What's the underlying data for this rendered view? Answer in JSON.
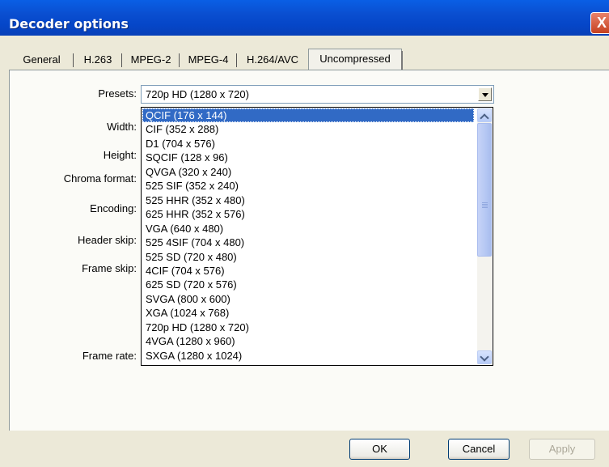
{
  "window": {
    "title": "Decoder options",
    "close_label": "X"
  },
  "tabs": [
    {
      "label": "General"
    },
    {
      "label": "H.263"
    },
    {
      "label": "MPEG-2"
    },
    {
      "label": "MPEG-4"
    },
    {
      "label": "H.264/AVC"
    },
    {
      "label": "Uncompressed"
    }
  ],
  "form": {
    "presets_label": "Presets:",
    "width_label": "Width:",
    "height_label": "Height:",
    "chroma_label": "Chroma format:",
    "encoding_label": "Encoding:",
    "header_skip_label": "Header skip:",
    "frame_skip_label": "Frame skip:",
    "frame_rate_label": "Frame rate:"
  },
  "presets": {
    "selected": "720p HD (1280 x 720)",
    "highlighted_index": 0,
    "options": [
      "QCIF (176 x 144)",
      "CIF (352 x 288)",
      "D1 (704 x 576)",
      "SQCIF (128 x 96)",
      "QVGA (320 x 240)",
      "525 SIF (352 x 240)",
      "525 HHR (352 x 480)",
      "625 HHR (352 x 576)",
      "VGA (640 x 480)",
      "525 4SIF (704 x 480)",
      "525 SD (720 x 480)",
      "4CIF (704 x 576)",
      "625 SD (720 x 576)",
      "SVGA (800 x 600)",
      "XGA (1024 x 768)",
      "720p HD (1280 x 720)",
      "4VGA (1280 x 960)",
      "SXGA (1280 x 1024)"
    ]
  },
  "buttons": {
    "ok": "OK",
    "cancel": "Cancel",
    "apply": "Apply"
  },
  "colors": {
    "titlebar": "#0a4ed0",
    "selection": "#316ac5",
    "face": "#ece9d8"
  }
}
